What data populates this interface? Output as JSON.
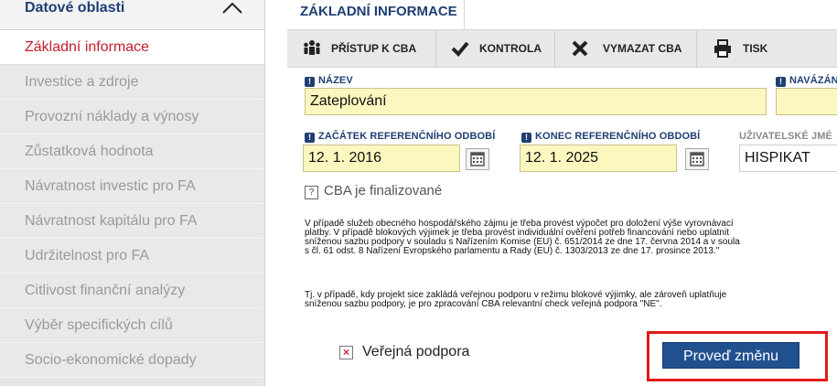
{
  "sidebar": {
    "header": "Datové oblasti",
    "items": [
      {
        "label": "Základní informace",
        "active": true
      },
      {
        "label": "Investice a zdroje"
      },
      {
        "label": "Provozní náklady a výnosy"
      },
      {
        "label": "Zůstatková hodnota"
      },
      {
        "label": "Návratnost investic pro FA"
      },
      {
        "label": "Návratnost kapitálu pro FA"
      },
      {
        "label": "Udržitelnost pro FA"
      },
      {
        "label": "Citlivost finanční analýzy"
      },
      {
        "label": "Výběr specifických cílů"
      },
      {
        "label": "Socio-ekonomické dopady"
      }
    ]
  },
  "main": {
    "tab": "ZÁKLADNÍ INFORMACE",
    "toolbar": {
      "access": "PŘÍSTUP K CBA",
      "check": "KONTROLA",
      "delete": "VYMAZAT CBA",
      "print": "TISK"
    },
    "form": {
      "name_label": "NÁZEV",
      "name_value": "Zateplování",
      "linked_label": "NAVÁZÁN",
      "start_label": "ZAČÁTEK REFERENČNÍHO ODBOBÍ",
      "start_value": "12. 1. 2016",
      "end_label": "KONEC REFERENČNÍHO OBDOBÍ",
      "end_value": "12. 1. 2025",
      "user_label": "UŽIVATELSKÉ JMÉ",
      "user_value": "HISPIKAT",
      "finalized": "CBA je finalizované"
    },
    "notes": [
      "V případě služeb obecného hospodářského zájmu je třeba provést výpočet pro doložení výše vyrovnávací",
      "platby. V případě blokových výjimek je třeba provést individuální ověření potřeb financování nebo uplatnit",
      "sníženou sazbu podpory v souladu s Nařízením Komise (EU) č. 651/2014 ze dne 17. června 2014 a v soula",
      "s čl. 61 odst. 8 Nařízení Evropského parlamentu a Rady (EU) č. 1303/2013 ze dne 17. prosince 2013.\"",
      "Tj. v případě, kdy projekt sice zakládá veřejnou podporu v režimu blokové výjimky, ale zároveň uplatňuje",
      "sníženou sazbu podpory, je pro zpracování CBA relevantní check veřejná podpora \"NE\"."
    ],
    "checkbox_label": "Veřejná podpora",
    "action_button": "Proveď změnu"
  },
  "colors": {
    "accent_navy": "#1f3f73",
    "active_red": "#c41e2b",
    "field_yellow": "#fbf7bf",
    "button_blue": "#21508f",
    "highlight_red": "#e11a1a"
  }
}
